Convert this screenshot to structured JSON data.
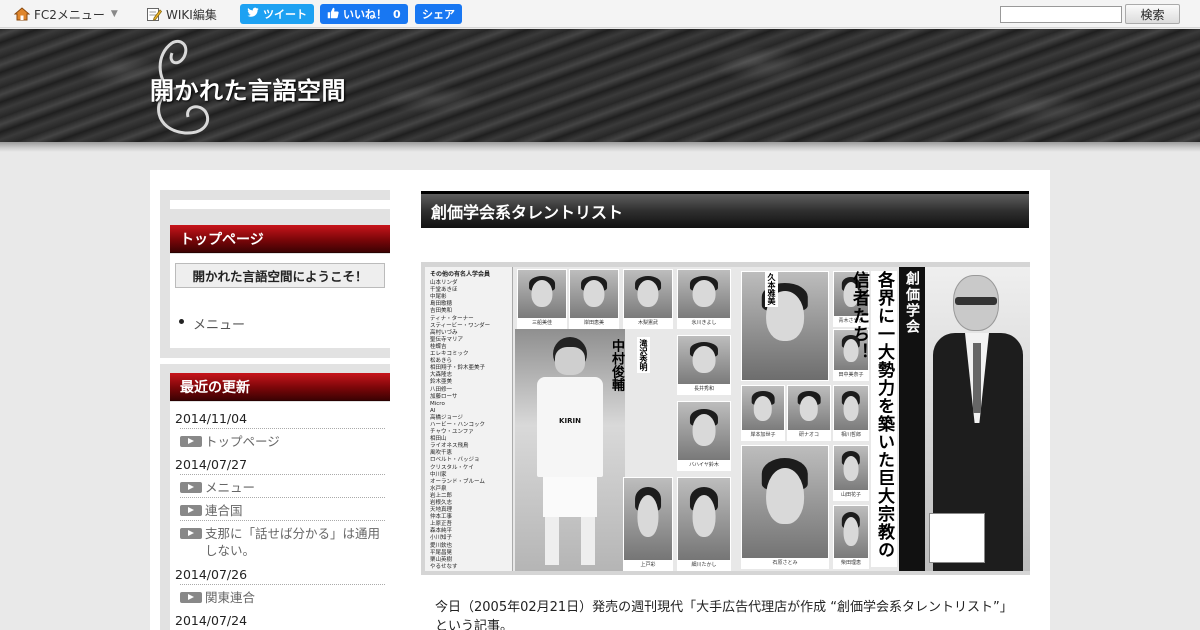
{
  "topbar": {
    "fc2_menu": "FC2メニュー",
    "wiki_edit": "WIKI編集",
    "tweet": "ツイート",
    "like": "いいね！",
    "like_count": "0",
    "share": "シェア",
    "search_placeholder": "",
    "search_button": "検索"
  },
  "header": {
    "site_title": "開かれた言語空間"
  },
  "sidebar": {
    "top_page": {
      "heading": "トップページ",
      "welcome": "開かれた言語空間にようこそ！",
      "menu_item": "メニュー"
    },
    "recent": {
      "heading": "最近の更新",
      "groups": [
        {
          "date": "2014/11/04",
          "items": [
            "トップページ"
          ]
        },
        {
          "date": "2014/07/27",
          "items": [
            "メニュー",
            "連合国",
            "支那に「話せば分かる」は通用しない。"
          ]
        },
        {
          "date": "2014/07/26",
          "items": [
            "関東連合"
          ]
        },
        {
          "date": "2014/07/24",
          "items": []
        }
      ]
    }
  },
  "article": {
    "title": "創価学会系タレントリスト",
    "photo": {
      "list_heading": "その他の有名人学会員",
      "names": [
        "山本リンダ",
        "千堂あきほ",
        "中尾彬",
        "島田歌穂",
        "吉田美和",
        "ティナ・ターナー",
        "スティービー・ワンダー",
        "高村いづみ",
        "聖伝寺マリア",
        "桂蝶吉",
        "エレキコミック",
        "松あきら",
        "相田翔子・鈴木亜美子",
        "大森隆志",
        "鈴木亜美",
        "八田修一",
        "加藤ローサ",
        "Micro",
        "AI",
        "高橋ジョージ",
        "ハービー・ハンコック",
        "チャウ・ユンファ",
        "相田山",
        "ライオネス飛鳥",
        "風吹千恵",
        "ロベルト・バッジョ",
        "クリスタル・ケイ",
        "中川家",
        "オーランド・ブルーム",
        "水戸泉",
        "岩上二郎",
        "岩根久志",
        "天地真理",
        "仲本工事",
        "上原正吾",
        "森本純平",
        "小川知子",
        "愛川欽也",
        "平尾昌晃",
        "栗山英樹",
        "やるせなす"
      ],
      "thumbs": [
        "三船美佳",
        "岸田恵美",
        "木梨憲武",
        "氷川きよし",
        "長井秀和",
        "バハイヤ鈴木",
        "上戸彩",
        "細川たかし",
        "青木さやか",
        "田中美奈子",
        "岸本加世子",
        "研ナオコ",
        "相川哲郎",
        "山田花子",
        "柴田理恵",
        "石原さとみ"
      ],
      "player_name": "中村俊輔",
      "player_kit": "KIRIN",
      "vertical_copy": "各界に一大勢力を築いた巨大宗教の信者たち！",
      "banner": "創価学会",
      "side_name": "久本雅美",
      "extra_name": "滝沢秀明"
    },
    "body": "今日（2005年02月21日）発売の週刊現代「大手広告代理店が作成 “創価学会系タレントリスト”」という記事。"
  }
}
